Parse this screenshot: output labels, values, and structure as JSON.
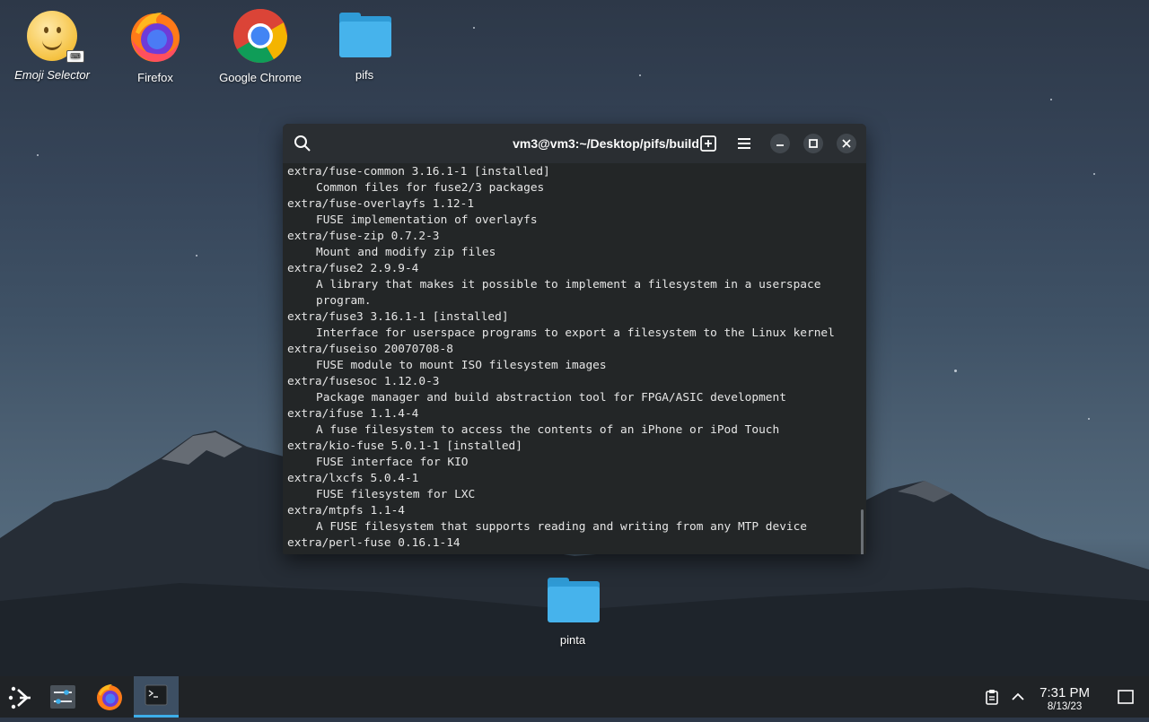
{
  "desktop": {
    "icons": [
      {
        "label": "Emoji Selector"
      },
      {
        "label": "Firefox"
      },
      {
        "label": "Google Chrome"
      },
      {
        "label": "pifs"
      },
      {
        "label": "pinta"
      }
    ]
  },
  "terminal": {
    "title": "vm3@vm3:~/Desktop/pifs/build",
    "lines": [
      "extra/fuse-common 3.16.1-1 [installed]",
      "Common files for fuse2/3 packages",
      "extra/fuse-overlayfs 1.12-1",
      "FUSE implementation of overlayfs",
      "extra/fuse-zip 0.7.2-3",
      "Mount and modify zip files",
      "extra/fuse2 2.9.9-4",
      "A library that makes it possible to implement a filesystem in a userspace",
      "program.",
      "extra/fuse3 3.16.1-1 [installed]",
      "Interface for userspace programs to export a filesystem to the Linux kernel",
      "extra/fuseiso 20070708-8",
      "FUSE module to mount ISO filesystem images",
      "extra/fusesoc 1.12.0-3",
      "Package manager and build abstraction tool for FPGA/ASIC development",
      "extra/ifuse 1.1.4-4",
      "A fuse filesystem to access the contents of an iPhone or iPod Touch",
      "extra/kio-fuse 5.0.1-1 [installed]",
      "FUSE interface for KIO",
      "extra/lxcfs 5.0.4-1",
      "FUSE filesystem for LXC",
      "extra/mtpfs 1.1-4",
      "A FUSE filesystem that supports reading and writing from any MTP device",
      "extra/perl-fuse 0.16.1-14"
    ]
  },
  "taskbar": {
    "time": "7:31 PM",
    "date": "8/13/23"
  },
  "colors": {
    "accent": "#3daee9",
    "terminal_bg": "#232627",
    "taskbar_bg": "#202326"
  }
}
